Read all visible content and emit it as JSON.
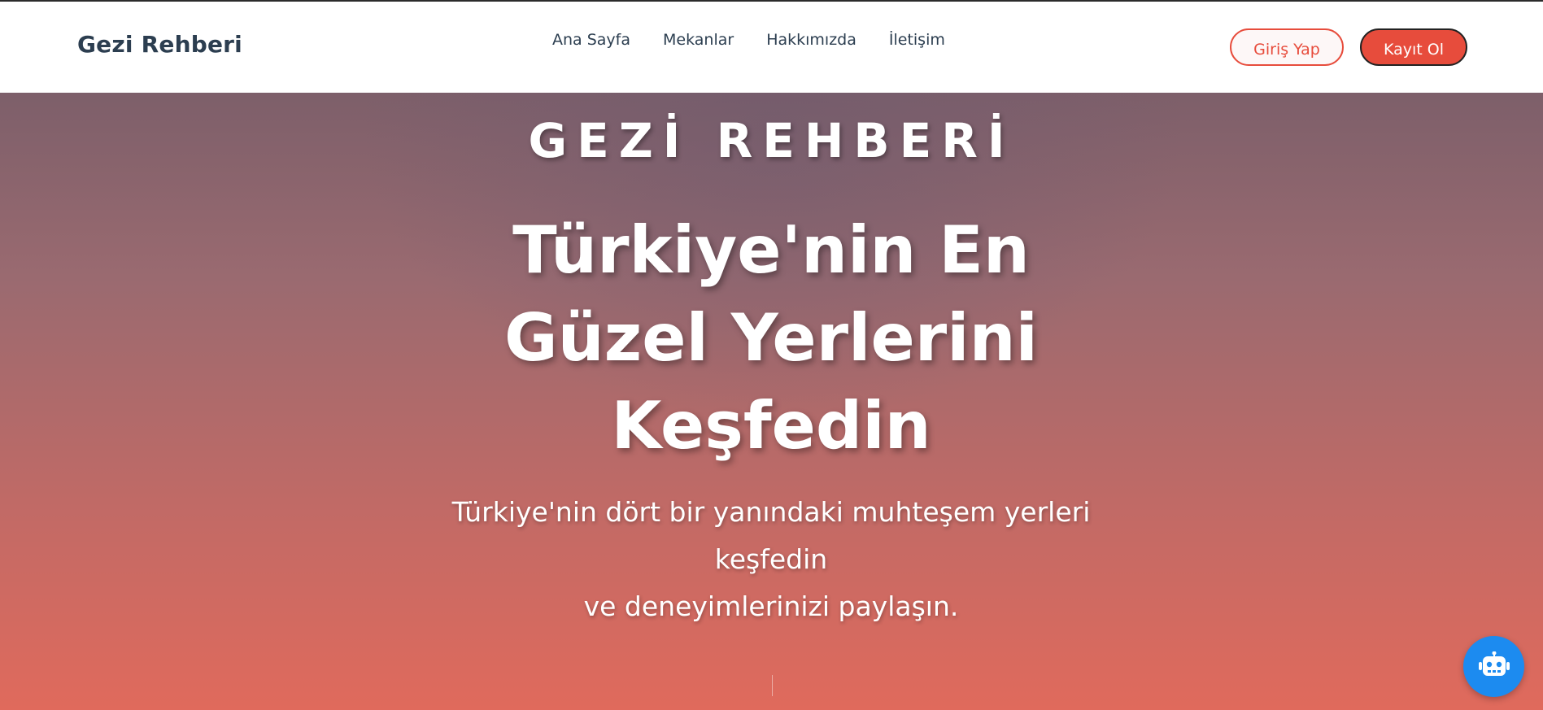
{
  "navbar": {
    "brand": "Gezi Rehberi",
    "links": [
      "Ana Sayfa",
      "Mekanlar",
      "Hakkımızda",
      "İletişim"
    ],
    "login_label": "Giriş Yap",
    "signup_label": "Kayıt Ol"
  },
  "hero": {
    "kicker": "GEZİ REHBERİ",
    "title_lines": [
      "Türkiye'nin En",
      "Güzel Yerlerini",
      "Keşfedin"
    ],
    "subtitle_lines": [
      "Türkiye'nin dört bir yanındaki muhteşem yerleri keşfedin",
      "ve deneyimlerinizi paylaşın."
    ]
  },
  "chatbot": {
    "icon": "robot-icon"
  },
  "colors": {
    "brand_text": "#2c3e50",
    "accent_red": "#e74c3c",
    "chatbot_blue": "#1c8bf0"
  }
}
